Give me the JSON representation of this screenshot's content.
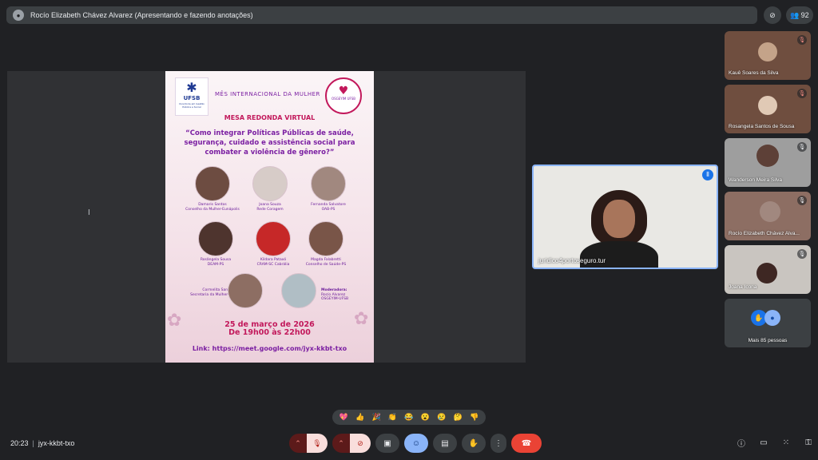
{
  "header": {
    "presenter_label": "Rocío Elizabeth Chávez Alvarez (Apresentando e fazendo anotações)",
    "participant_count": "92"
  },
  "slide": {
    "logo_left": "UFSB",
    "logo_left_sub": "Ouvidoria em Gestão Pública e Social",
    "logo_right_sub": "OSGEYIM UFSB",
    "heading": "MÊS INTERNACIONAL DA MULHER",
    "subheading": "MESA REDONDA VIRTUAL",
    "question": "“Como integrar Políticas Públicas de saúde, segurança, cuidado e assistência social para combater a violência de gênero?”",
    "speakers": [
      {
        "name": "Damaris Santos",
        "role": "Conselho da Mulher-Eunápolis"
      },
      {
        "name": "Joana Souza",
        "role": "Rede Coragem"
      },
      {
        "name": "Fernanda Salvatore",
        "role": "OAB-PS"
      },
      {
        "name": "Rosângela Sousa",
        "role": "DEAM-PS"
      },
      {
        "name": "Kildara Pataxó",
        "role": "CRAM-SC Cabrália"
      },
      {
        "name": "Magda Falabretti",
        "role": "Conselho de Saúde-PS"
      }
    ],
    "bottom_left": {
      "name": "Cormelita Santos",
      "role": "Secretaria da Mulher-PS"
    },
    "moderator": {
      "label": "Moderadora:",
      "name": "Rocío Alvarez",
      "role": "OSGEYIM-UFSB"
    },
    "date_line1": "25 de março de 2026",
    "date_line2": "De 19h00 às 22h00",
    "link": "Link: https://meet.google.com/jyx-kkbt-txo"
  },
  "camera": {
    "label": "juridico4portoseguro.tur"
  },
  "participants": [
    {
      "name": "Kauê Soares da Silva",
      "muted": true
    },
    {
      "name": "Rosangela Santos de Sousa",
      "muted": true
    },
    {
      "name": "Wanderson Meira Silva",
      "muted": true
    },
    {
      "name": "Rocío Elizabeth Chávez Alva...",
      "muted": true
    },
    {
      "name": "Joana Icona",
      "muted": true
    }
  ],
  "more_people": "Mais 85 pessoas",
  "reactions": [
    "💖",
    "👍",
    "🎉",
    "👏",
    "😂",
    "😮",
    "😢",
    "🤔",
    "👎"
  ],
  "footer": {
    "time": "20:23",
    "meeting_code": "jyx-kkbt-txo"
  },
  "colors": {
    "bg": "#202124",
    "surface": "#3c4043",
    "accent_blue": "#8ab4f8",
    "danger": "#ea4335",
    "slide_pink": "#c2185b",
    "slide_purple": "#7b1fa2"
  }
}
